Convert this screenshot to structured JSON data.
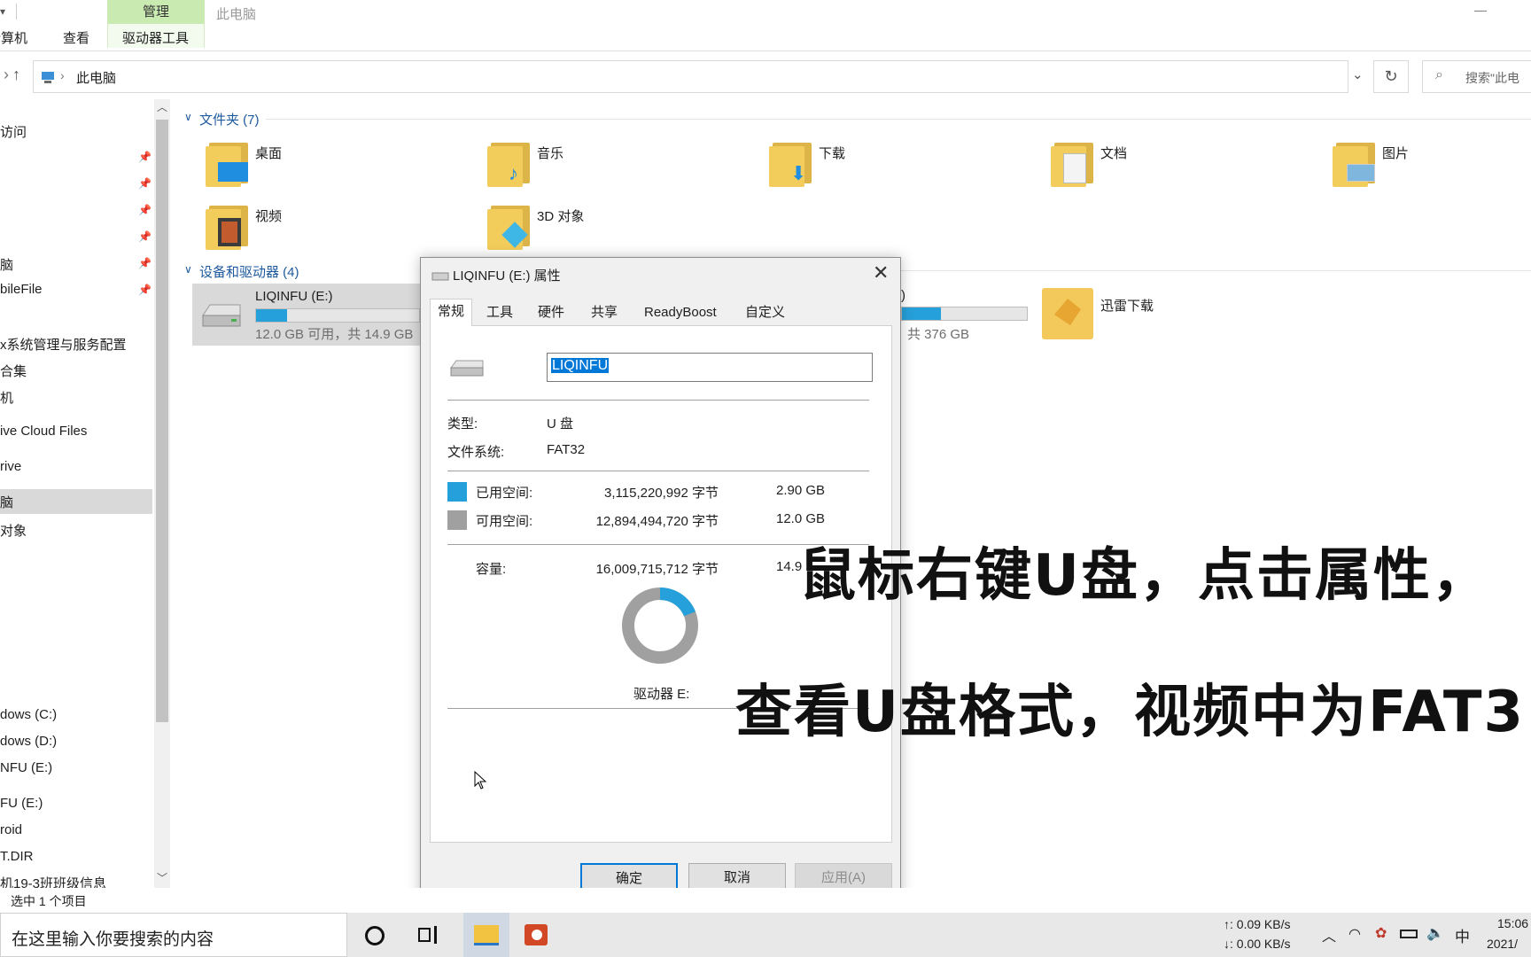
{
  "ribbon": {
    "tab_computer": "计算机",
    "tab_view": "查看",
    "tab_manage": "管理",
    "tab_drive_tools": "驱动器工具",
    "window_title": "此电脑"
  },
  "address": {
    "path": "此电脑",
    "search_placeholder": "搜索\"此电"
  },
  "sidebar": {
    "items": [
      "访问",
      "脑",
      "bileFile",
      "x系统管理与服务配置",
      "合集",
      "机",
      "ive Cloud Files",
      "rive",
      "脑",
      "对象",
      "dows (C:)",
      "dows (D:)",
      "NFU (E:)",
      "FU (E:)",
      "roid",
      "T.DIR",
      "机19-3班班级信息"
    ]
  },
  "folders_group": {
    "header": "文件夹 (7)",
    "items": [
      {
        "label": "桌面",
        "icon": "desktop-folder-icon"
      },
      {
        "label": "音乐",
        "icon": "music-folder-icon"
      },
      {
        "label": "下载",
        "icon": "downloads-folder-icon"
      },
      {
        "label": "文档",
        "icon": "documents-folder-icon"
      },
      {
        "label": "图片",
        "icon": "pictures-folder-icon"
      },
      {
        "label": "视频",
        "icon": "videos-folder-icon"
      },
      {
        "label": "3D 对象",
        "icon": "3d-objects-folder-icon"
      }
    ]
  },
  "devices_group": {
    "header": "设备和驱动器 (4)",
    "drive_e": {
      "name": "LIQINFU (E:)",
      "space": "12.0 GB 可用，共 14.9 GB",
      "used_fraction": 0.19
    },
    "drive_other": {
      "name_tail": ")",
      "space": "共 376 GB",
      "used_fraction": 0.31
    },
    "xunlei": {
      "name": "迅雷下载"
    }
  },
  "dialog": {
    "title": "LIQINFU (E:) 属性",
    "tabs": [
      "常规",
      "工具",
      "硬件",
      "共享",
      "ReadyBoost",
      "自定义"
    ],
    "volume_name": "LIQINFU",
    "type_label": "类型:",
    "type_value": "U 盘",
    "fs_label": "文件系统:",
    "fs_value": "FAT32",
    "used_label": "已用空间:",
    "used_bytes": "3,115,220,992 字节",
    "used_size": "2.90 GB",
    "free_label": "可用空间:",
    "free_bytes": "12,894,494,720 字节",
    "free_size": "12.0 GB",
    "capacity_label": "容量:",
    "capacity_bytes": "16,009,715,712 字节",
    "capacity_size": "14.9",
    "drive_label": "驱动器 E:",
    "used_fraction": 0.19,
    "ok": "确定",
    "cancel": "取消",
    "apply": "应用(A)"
  },
  "subtitles": {
    "line1": "鼠标右键U盘，点击属性，",
    "line2": "查看U盘格式，视频中为FAT3"
  },
  "status": {
    "text": "选中 1 个项目"
  },
  "taskbar": {
    "search_placeholder": "在这里输入你要搜索的内容",
    "net_up": "↑: 0.09 KB/s",
    "net_down": "↓: 0.00 KB/s",
    "ime": "中",
    "time": "15:06",
    "date": "2021/"
  },
  "colors": {
    "used": "#26a0da",
    "free": "#a0a0a0",
    "manage_tab": "#c9eab0"
  }
}
